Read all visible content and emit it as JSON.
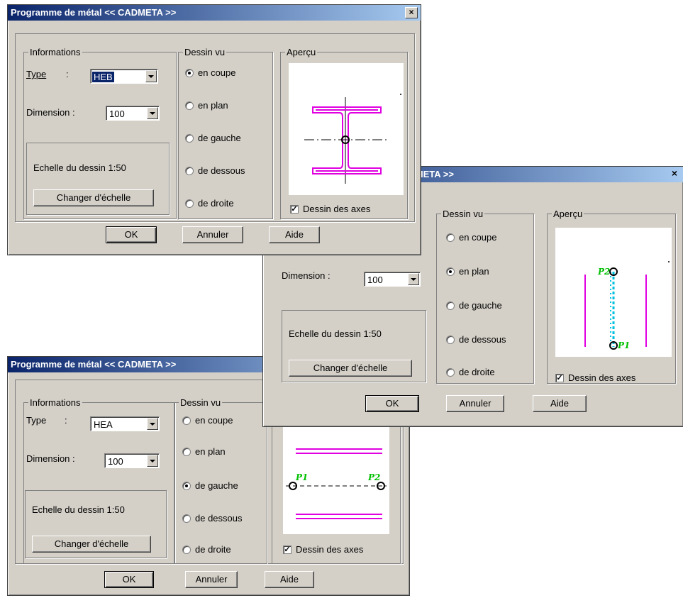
{
  "colors": {
    "magenta": "#e000e0",
    "green": "#00c000",
    "cyan": "#00c0e0",
    "title_dark": "#0a246a"
  },
  "dialog_a": {
    "title": "Programme de métal << CADMETA >>",
    "close": "×",
    "info_group": "Informations",
    "type_label": "Type",
    "type_colon": ":",
    "type_value": "HEB",
    "dimension_label": "Dimension :",
    "dimension_value": "100",
    "scale_text": "Echelle du dessin 1:50",
    "change_scale": "Changer d'échelle",
    "view_group": "Dessin vu",
    "views": [
      "en coupe",
      "en plan",
      "de gauche",
      "de dessous",
      "de droite"
    ],
    "selected_view": 0,
    "preview_group": "Aperçu",
    "axes_label": "Dessin des axes",
    "axes_checked": true,
    "ok": "OK",
    "cancel": "Annuler",
    "help": "Aide"
  },
  "dialog_b": {
    "title_fragment": "IETA >>",
    "close": "×",
    "dimension_label": "Dimension :",
    "dimension_value": "100",
    "scale_text": "Echelle du dessin 1:50",
    "change_scale": "Changer d'échelle",
    "view_group": "Dessin vu",
    "views": [
      "en coupe",
      "en plan",
      "de gauche",
      "de dessous",
      "de droite"
    ],
    "selected_view": 1,
    "preview_group": "Aperçu",
    "point1": "P1",
    "point2": "P2",
    "axes_label": "Dessin des axes",
    "axes_checked": true,
    "ok": "OK",
    "cancel": "Annuler",
    "help": "Aide"
  },
  "dialog_c": {
    "title": "Programme de métal << CADMETA >>",
    "info_group": "Informations",
    "type_label": "Type",
    "type_colon": ":",
    "type_value": "HEA",
    "dimension_label": "Dimension :",
    "dimension_value": "100",
    "scale_text": "Echelle du dessin 1:50",
    "change_scale": "Changer d'échelle",
    "view_group": "Dessin vu",
    "views": [
      "en coupe",
      "en plan",
      "de gauche",
      "de dessous",
      "de droite"
    ],
    "selected_view": 2,
    "point1": "P1",
    "point2": "P2",
    "axes_label": "Dessin des axes",
    "axes_checked": true,
    "ok": "OK",
    "cancel": "Annuler",
    "help": "Aide"
  }
}
